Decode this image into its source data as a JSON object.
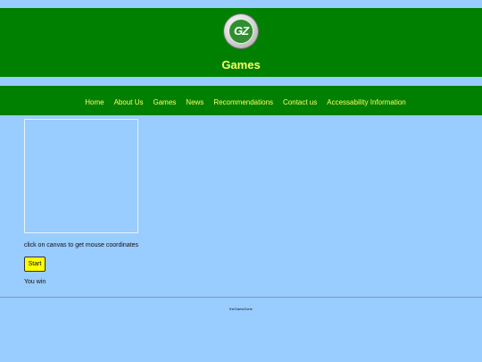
{
  "header": {
    "logo_text": "GZ",
    "title": "Games"
  },
  "nav": {
    "items": [
      {
        "label": "Home"
      },
      {
        "label": "About Us"
      },
      {
        "label": "Games"
      },
      {
        "label": "News"
      },
      {
        "label": "Recommendations"
      },
      {
        "label": "Contact us"
      },
      {
        "label": "Accessability Information"
      }
    ]
  },
  "main": {
    "instruction": "click on canvas to get mouse coordinates",
    "start_label": "Start",
    "result": "You win"
  },
  "footer": {
    "text": "theGameZone"
  },
  "colors": {
    "page_background": "#99ccff",
    "bar_green": "#008000",
    "accent_yellow": "#ffff66",
    "button_yellow": "#ffff00"
  }
}
